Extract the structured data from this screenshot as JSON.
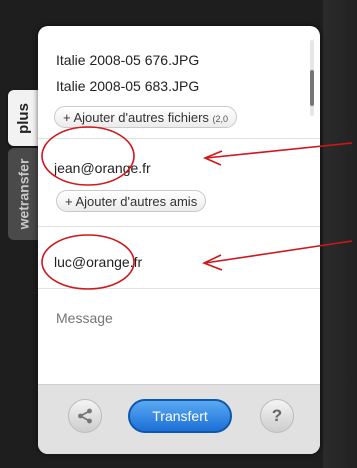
{
  "side_tabs": [
    {
      "label": "plus"
    },
    {
      "label": "wetransfer"
    }
  ],
  "files": [
    {
      "name": "Italie 2008-05 676.JPG"
    },
    {
      "name": "Italie 2008-05 683.JPG"
    }
  ],
  "add_files_button": {
    "label": "+ Ajouter d'autres fichiers",
    "size": "(2,0"
  },
  "recipients": {
    "friend_email": "jean@orange.fr",
    "add_friends_label": "+ Ajouter d'autres amis"
  },
  "sender_email": "luc@orange.fr",
  "message": {
    "placeholder": "Message"
  },
  "footer": {
    "share_icon": "share-icon",
    "transfer_label": "Transfert",
    "help_label": "?"
  },
  "annotation_color": "#d0161b"
}
